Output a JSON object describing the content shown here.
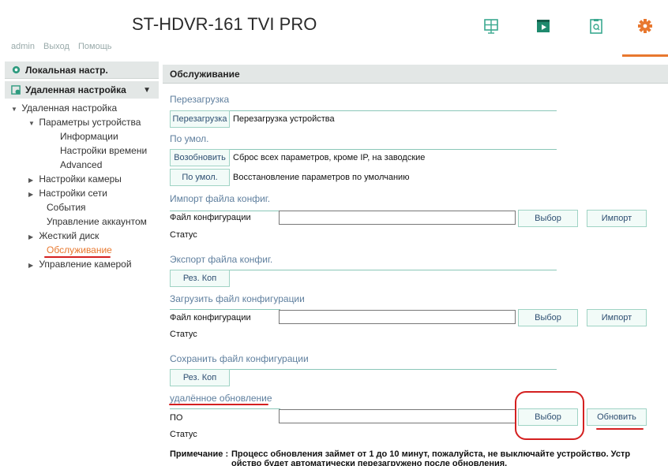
{
  "header": {
    "title": "ST-HDVR-161 TVI PRO",
    "user": "admin",
    "logout": "Выход",
    "help": "Помощь",
    "icons": [
      "live-view-icon",
      "playback-icon",
      "log-icon",
      "gear-icon"
    ],
    "accent": "#e8782f"
  },
  "sidebar": {
    "local": "Локальная настр.",
    "remote": "Удаленная настройка",
    "tree": {
      "root": "Удаленная настройка",
      "device_params": "Параметры устройства",
      "info": "Информации",
      "time": "Настройки времени",
      "advanced": "Advanced",
      "camera": "Настройки камеры",
      "network": "Настройки сети",
      "events": "События",
      "accounts": "Управление аккаунтом",
      "hdd": "Жесткий диск",
      "maintenance": "Обслуживание",
      "camera_ctrl": "Управление камерой"
    }
  },
  "main": {
    "title": "Обслуживание",
    "reboot": {
      "section": "Перезагрузка",
      "button": "Перезагрузка",
      "desc": "Перезагрузка устройства"
    },
    "default": {
      "section": "По умол.",
      "restore_button": "Возобновить",
      "restore_desc": "Сброс всех параметров, кроме IP, на заводские",
      "default_button": "По умол.",
      "default_desc": "Восстановление параметров по умолчанию"
    },
    "import": {
      "section": "Импорт файла конфиг.",
      "file_label": "Файл конфигурации",
      "browse": "Выбор",
      "import": "Импорт",
      "status": "Статус"
    },
    "export": {
      "section": "Экспорт файла конфиг.",
      "button": "Рез. Коп"
    },
    "upload": {
      "section": "Загрузить файл конфигурации",
      "file_label": "Файл конфигурации",
      "browse": "Выбор",
      "import": "Импорт",
      "status": "Статус"
    },
    "save": {
      "section": "Сохранить файл конфигурации",
      "button": "Рез. Коп"
    },
    "upgrade": {
      "section": "удалённое обновление",
      "file_label": "ПО",
      "browse": "Выбор",
      "update": "Обновить",
      "status": "Статус"
    },
    "note": {
      "label": "Примечание :",
      "text": "Процесс обновления займет от 1 до 10 минут, пожалуйста, не выключайте устройство. Устр ойство будет автоматически перезагружено после обновления."
    }
  }
}
